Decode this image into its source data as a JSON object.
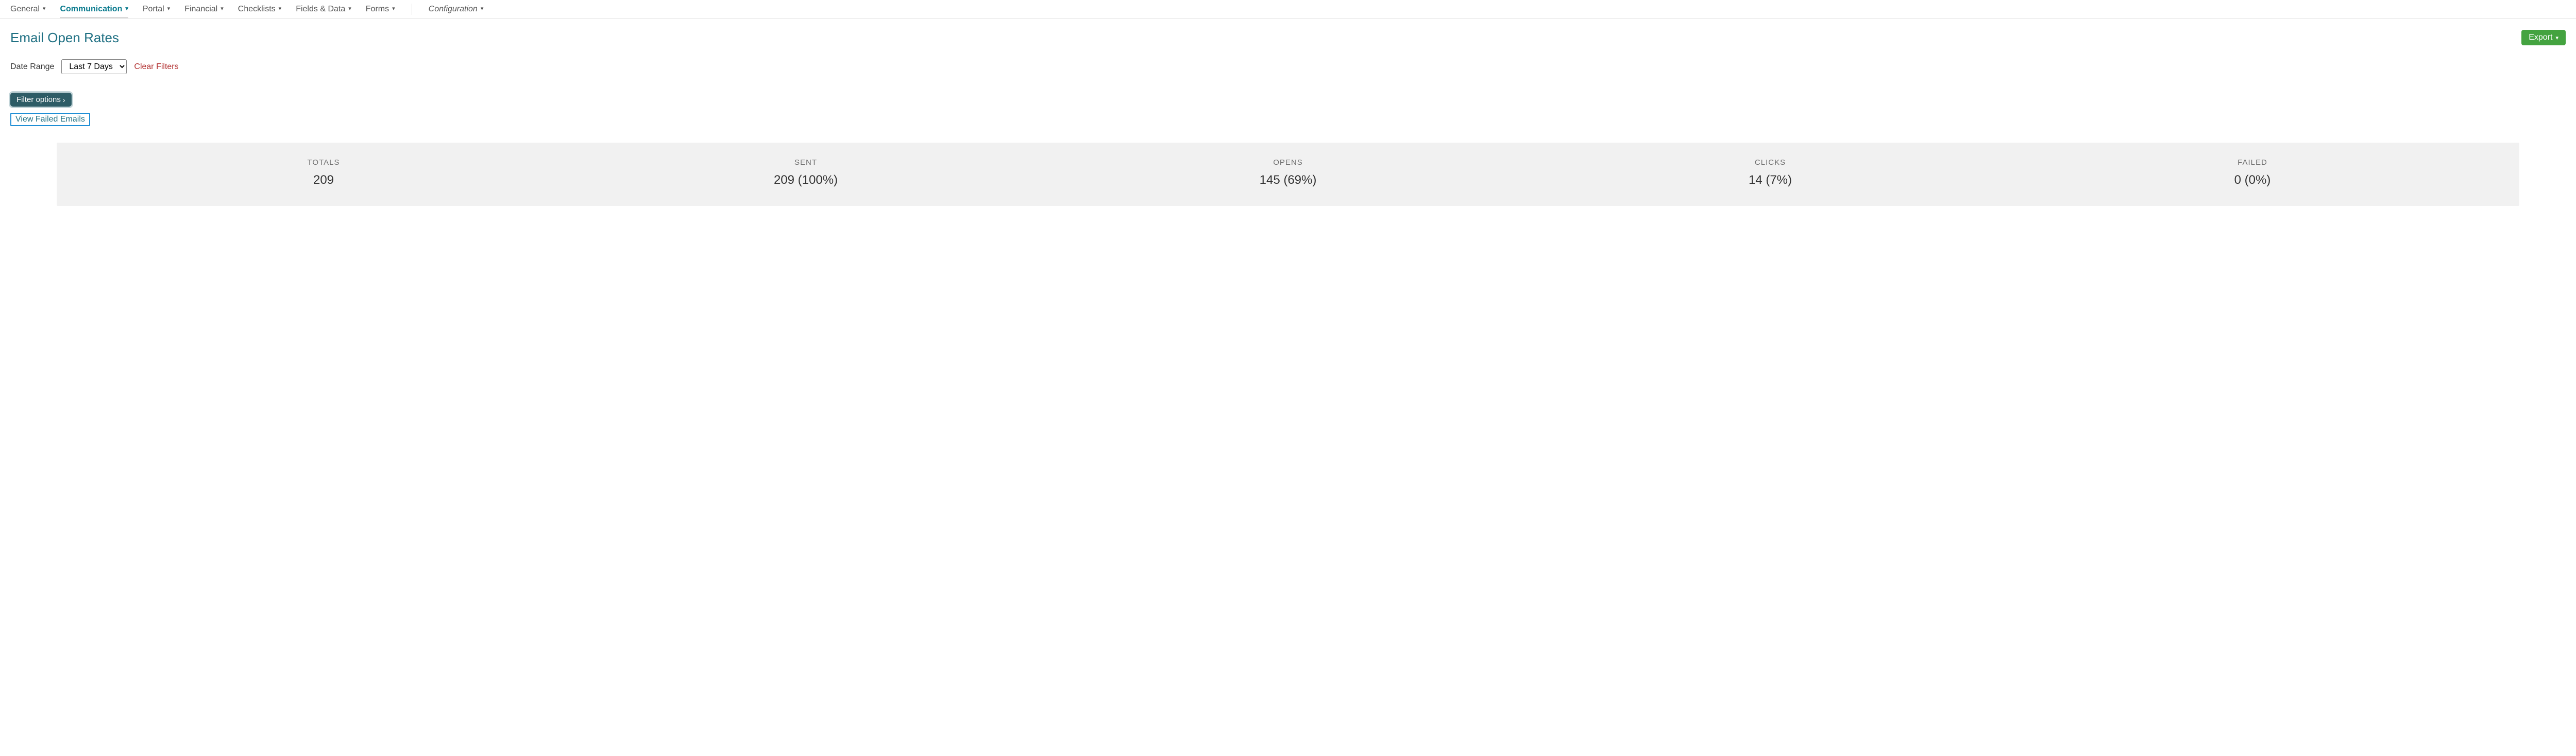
{
  "nav": {
    "tabs": [
      {
        "label": "General"
      },
      {
        "label": "Communication"
      },
      {
        "label": "Portal"
      },
      {
        "label": "Financial"
      },
      {
        "label": "Checklists"
      },
      {
        "label": "Fields & Data"
      },
      {
        "label": "Forms"
      }
    ],
    "configuration_label": "Configuration"
  },
  "page": {
    "title": "Email Open Rates",
    "export_label": "Export"
  },
  "filters": {
    "date_range_label": "Date Range",
    "date_range_value": "Last 7 Days",
    "clear_label": "Clear Filters",
    "filter_options_label": "Filter options",
    "view_failed_label": "View Failed Emails"
  },
  "stats": [
    {
      "label": "TOTALS",
      "value": "209"
    },
    {
      "label": "SENT",
      "value": "209 (100%)"
    },
    {
      "label": "OPENS",
      "value": "145 (69%)"
    },
    {
      "label": "CLICKS",
      "value": "14 (7%)"
    },
    {
      "label": "FAILED",
      "value": "0 (0%)"
    }
  ]
}
